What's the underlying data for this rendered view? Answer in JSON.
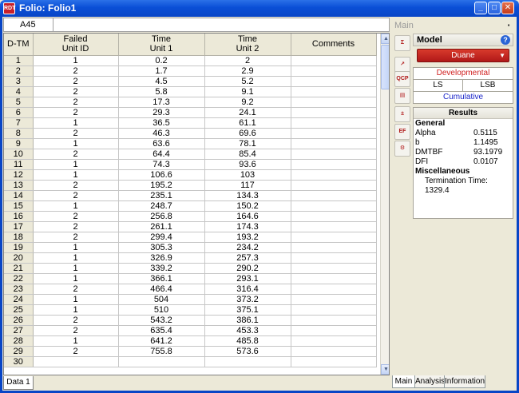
{
  "window": {
    "title": "Folio: Folio1",
    "app_icon": "RDT",
    "buttons": {
      "minimize": "_",
      "maximize": "□",
      "close": "✕"
    }
  },
  "cell_ref": {
    "value": "A45"
  },
  "grid": {
    "headers": {
      "row": "D-TM",
      "col1a": "Failed",
      "col1b": "Unit ID",
      "col2a": "Time",
      "col2b": "Unit 1",
      "col3a": "Time",
      "col3b": "Unit 2",
      "col4": "Comments"
    },
    "rows": [
      [
        "1",
        "1",
        "0.2",
        "2"
      ],
      [
        "2",
        "2",
        "1.7",
        "2.9"
      ],
      [
        "3",
        "2",
        "4.5",
        "5.2"
      ],
      [
        "4",
        "2",
        "5.8",
        "9.1"
      ],
      [
        "5",
        "2",
        "17.3",
        "9.2"
      ],
      [
        "6",
        "2",
        "29.3",
        "24.1"
      ],
      [
        "7",
        "1",
        "36.5",
        "61.1"
      ],
      [
        "8",
        "2",
        "46.3",
        "69.6"
      ],
      [
        "9",
        "1",
        "63.6",
        "78.1"
      ],
      [
        "10",
        "2",
        "64.4",
        "85.4"
      ],
      [
        "11",
        "1",
        "74.3",
        "93.6"
      ],
      [
        "12",
        "1",
        "106.6",
        "103"
      ],
      [
        "13",
        "2",
        "195.2",
        "117"
      ],
      [
        "14",
        "2",
        "235.1",
        "134.3"
      ],
      [
        "15",
        "1",
        "248.7",
        "150.2"
      ],
      [
        "16",
        "2",
        "256.8",
        "164.6"
      ],
      [
        "17",
        "2",
        "261.1",
        "174.3"
      ],
      [
        "18",
        "2",
        "299.4",
        "193.2"
      ],
      [
        "19",
        "1",
        "305.3",
        "234.2"
      ],
      [
        "20",
        "1",
        "326.9",
        "257.3"
      ],
      [
        "21",
        "1",
        "339.2",
        "290.2"
      ],
      [
        "22",
        "1",
        "366.1",
        "293.1"
      ],
      [
        "23",
        "2",
        "466.4",
        "316.4"
      ],
      [
        "24",
        "1",
        "504",
        "373.2"
      ],
      [
        "25",
        "1",
        "510",
        "375.1"
      ],
      [
        "26",
        "2",
        "543.2",
        "386.1"
      ],
      [
        "27",
        "2",
        "635.4",
        "453.3"
      ],
      [
        "28",
        "1",
        "641.2",
        "485.8"
      ],
      [
        "29",
        "2",
        "755.8",
        "573.6"
      ],
      [
        "30",
        "",
        "",
        ""
      ]
    ]
  },
  "sheet_tab": "Data 1",
  "panel": {
    "header": "Main",
    "model_label": "Model",
    "model_value": "Duane",
    "options": {
      "developmental": "Developmental",
      "ls": "LS",
      "lsb": "LSB",
      "cumulative": "Cumulative"
    },
    "results": {
      "title": "Results",
      "general": "General",
      "alpha_label": "Alpha",
      "alpha_value": "0.5115",
      "b_label": "b",
      "b_value": "1.1495",
      "dmtbf_label": "DMTBF",
      "dmtbf_value": "93.1979",
      "dfi_label": "DFI",
      "dfi_value": "0.0107",
      "misc": "Miscellaneous",
      "termination": "Termination Time: 1329.4"
    },
    "tools": [
      "calc-icon",
      "plot-icon",
      "qcp-icon",
      "report-icon",
      "transfer-icon",
      "ef-icon",
      "wrench-icon"
    ],
    "tool_glyphs": [
      "Σ",
      "↗",
      "QCP",
      "▤",
      "±",
      "EF",
      "⚙"
    ]
  },
  "bottom_tabs": [
    "Main",
    "Analysis",
    "Information"
  ],
  "colors": {
    "accent_red": "#b01818",
    "title_blue": "#0a4fd6"
  }
}
